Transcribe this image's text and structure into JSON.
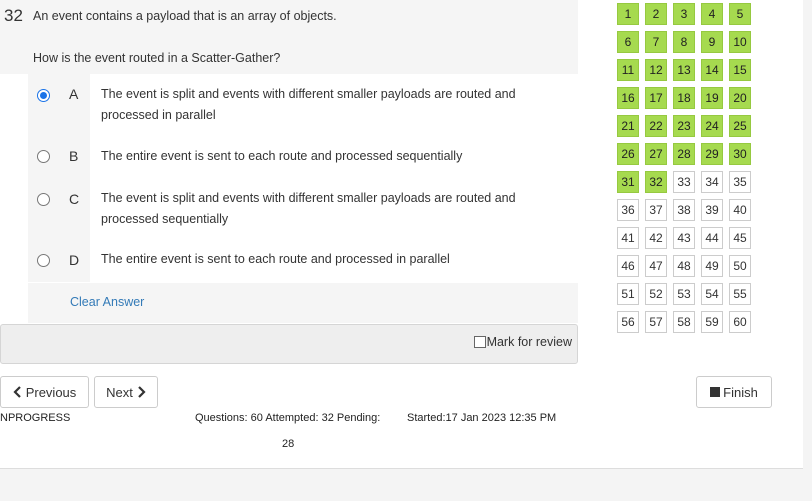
{
  "question": {
    "number": "32",
    "line1": "An event contains a payload that is an array of objects.",
    "line2": "How is the event routed in a Scatter-Gather?"
  },
  "options": [
    {
      "letter": "A",
      "text": "The event is split and events with different smaller payloads are routed and processed in parallel",
      "selected": true
    },
    {
      "letter": "B",
      "text": "The entire event is sent to each route and processed sequentially",
      "selected": false
    },
    {
      "letter": "C",
      "text": "The event is split and events with different smaller payloads are routed and processed sequentially",
      "selected": false
    },
    {
      "letter": "D",
      "text": "The entire event is sent to each route and processed in parallel",
      "selected": false
    }
  ],
  "clear_answer": "Clear Answer",
  "mark_review": "Mark for review",
  "nav": {
    "previous": "Previous",
    "next": "Next",
    "finish": "Finish"
  },
  "status": "NPROGRESS",
  "stats": {
    "questions": "Questions: 60 Attempted: 32 Pending:",
    "pending": "28",
    "started": "Started:17 Jan 2023 12:35 PM"
  },
  "grid": {
    "total": 60,
    "attempted": 32,
    "attempted_color": "#a6da4f"
  }
}
